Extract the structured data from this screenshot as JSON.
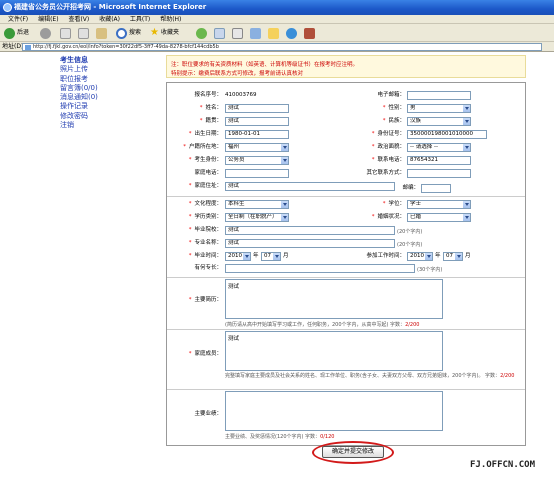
{
  "window": {
    "title": "福建省公务员公开招考网 - Microsoft Internet Explorer"
  },
  "menu": [
    "文件(F)",
    "编辑(E)",
    "查看(V)",
    "收藏(A)",
    "工具(T)",
    "帮助(H)"
  ],
  "toolbar": {
    "back": "后退",
    "search": "搜索",
    "favorites": "收藏夹"
  },
  "address": {
    "label": "地址(D)",
    "url": "http://fj.fjkl.gov.cn/eol/info?token=30f22df5-3ff7-49da-8278-bfcf144cdb5b"
  },
  "sidebar": [
    "考生信息",
    "照片上传",
    "职位报考",
    "留言簿(0/0)",
    "消息通知(0)",
    "操作记录",
    "修改密码",
    "注销"
  ],
  "notice": {
    "line1": "注：职位要求的有关资质材料（如英语、计算机等级证书）在报考时应注明。",
    "line2": "特别提示：缴费后联系方式可修改，报考前请认真核对"
  },
  "form": {
    "reg_no_label": "报名序号：",
    "reg_no": "410003769",
    "email_label": "电子邮箱：",
    "name_label": "姓名：",
    "name": "测试",
    "gender_label": "性别：",
    "gender": "男",
    "native_label": "籍贯：",
    "native": "测试",
    "ethnic_label": "民族：",
    "ethnic": "汉族",
    "birth_label": "出生日期：",
    "birth": "1980-01-01",
    "id_label": "身份证号：",
    "id": "350000198001010000",
    "hukou_label": "户籍所在地：",
    "hukou": "福州",
    "political_label": "政治面貌：",
    "political": "-- 请选择 --",
    "status_label": "考生身份：",
    "status": "公务员",
    "phone_label": "联系电话：",
    "phone": "87654321",
    "homephone_label": "家庭电话：",
    "othercontact_label": "其它联系方式：",
    "address_label": "家庭住址：",
    "address": "测试",
    "postcode_label": "邮编：",
    "edu_label": "文化程度：",
    "edu": "本科生",
    "degree_label": "学位：",
    "degree": "学士",
    "eduform_label": "学历类别：",
    "eduform": "全日制（在职脱产）",
    "marital_label": "婚姻状况：",
    "marital": "已婚",
    "school_label": "毕业院校：",
    "school": "测试",
    "school_hint": "(20个字内)",
    "major_label": "专业名称：",
    "major": "测试",
    "major_hint": "(20个字内)",
    "gradtime_label": "毕业时间：",
    "grad_year": "2010",
    "year_unit": "年",
    "grad_month": "07",
    "month_unit": "月",
    "worktime_label": "参加工作时间：",
    "work_year": "2010",
    "work_month": "07",
    "skill_label": "有何专长：",
    "skill_hint": "(30个字内)",
    "resume_label": "主要简历：",
    "resume": "测试",
    "resume_hint": "(简历请从高中开始填写学习或工作，任何职务，200个字内，从高中写起)",
    "resume_count_label": "字数：",
    "resume_count": "2/200",
    "family_label": "家庭成员：",
    "family": "测试",
    "family_hint": "完整填写家庭主要成员及社会关系的姓名、现工作单位、职务(含子女、夫妻双方父母、双方兄弟姐妹，200个字内)。",
    "family_count_label": "字数：",
    "family_count": "2/200",
    "perf_label": "主要业绩：",
    "perf_hint": "主要业绩、及奖惩情况(120个字内)",
    "perf_count_label": "字数：",
    "perf_count": "0/120"
  },
  "submit": "确定并提交修改",
  "watermark": "FJ.OFFCN.COM"
}
